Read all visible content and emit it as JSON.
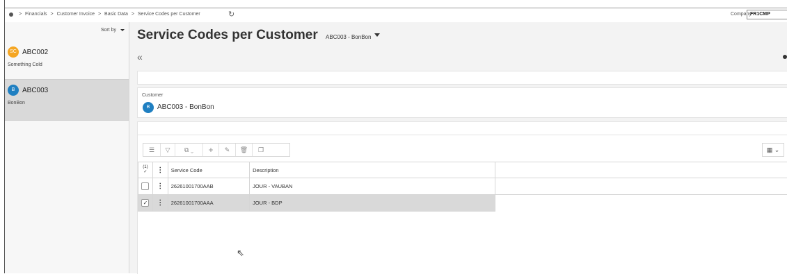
{
  "breadcrumb": {
    "items": [
      "Financials",
      "Customer Invoice",
      "Basic Data",
      "Service Codes per Customer"
    ],
    "separator": ">",
    "company_label": "Company",
    "company_value": "FR1CMP"
  },
  "sidebar": {
    "sort_label": "Sort by",
    "items": [
      {
        "initials": "SC",
        "code": "ABC002",
        "name": "Something Cold",
        "color": "#f5a623"
      },
      {
        "initials": "B",
        "code": "ABC003",
        "name": "BonBon",
        "color": "#1f7fc1"
      }
    ]
  },
  "page": {
    "title": "Service Codes per Customer",
    "record": "ABC003 - BonBon",
    "customer_label": "Customer",
    "customer_initials": "B",
    "customer_value": "ABC003 - BonBon"
  },
  "table": {
    "selection_count": "(1)",
    "headers": [
      "Service Code",
      "Description"
    ],
    "rows": [
      {
        "service_code": "26261001700AAB",
        "description": "JOUR - VAUBAN",
        "checked": false
      },
      {
        "service_code": "26261001700AAA",
        "description": "JOUR - BDP",
        "checked": true
      }
    ]
  }
}
